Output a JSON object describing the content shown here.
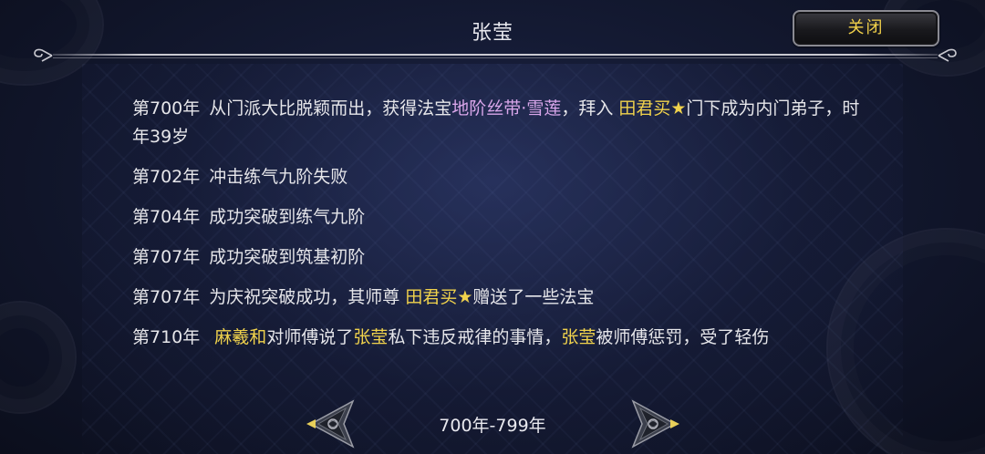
{
  "header": {
    "title": "张莹",
    "close_label": "关闭"
  },
  "entries": [
    {
      "year": "第700年",
      "parts": [
        {
          "text": "从门派大比脱颖而出，获得法宝",
          "style": "normal"
        },
        {
          "text": "地阶丝带·雪莲",
          "style": "purple"
        },
        {
          "text": "，拜入 ",
          "style": "normal"
        },
        {
          "text": "田君买★",
          "style": "gold"
        },
        {
          "text": "门下成为内门弟子，时年39岁",
          "style": "normal"
        }
      ]
    },
    {
      "year": "第702年",
      "parts": [
        {
          "text": "冲击练气九阶失败",
          "style": "normal"
        }
      ]
    },
    {
      "year": "第704年",
      "parts": [
        {
          "text": "成功突破到练气九阶",
          "style": "normal"
        }
      ]
    },
    {
      "year": "第707年",
      "parts": [
        {
          "text": "成功突破到筑基初阶",
          "style": "normal"
        }
      ]
    },
    {
      "year": "第707年",
      "parts": [
        {
          "text": "为庆祝突破成功，其师尊 ",
          "style": "normal"
        },
        {
          "text": "田君买★",
          "style": "gold"
        },
        {
          "text": "赠送了一些法宝",
          "style": "normal"
        }
      ]
    },
    {
      "year": "第710年",
      "parts": [
        {
          "text": " 麻羲和",
          "style": "gold"
        },
        {
          "text": "对师傅说了",
          "style": "normal"
        },
        {
          "text": "张莹",
          "style": "gold"
        },
        {
          "text": "私下违反戒律的事情，",
          "style": "normal"
        },
        {
          "text": "张莹",
          "style": "gold"
        },
        {
          "text": "被师傅惩罚，受了轻伤",
          "style": "normal"
        }
      ]
    }
  ],
  "footer": {
    "page_range": "700年-799年",
    "prev_icon": "ornate-left-arrow-icon",
    "next_icon": "ornate-right-arrow-icon"
  },
  "colors": {
    "gold": "#f0d24c",
    "purple": "#d9a6ea",
    "text": "#e6e6ea",
    "background": "#141a33"
  }
}
